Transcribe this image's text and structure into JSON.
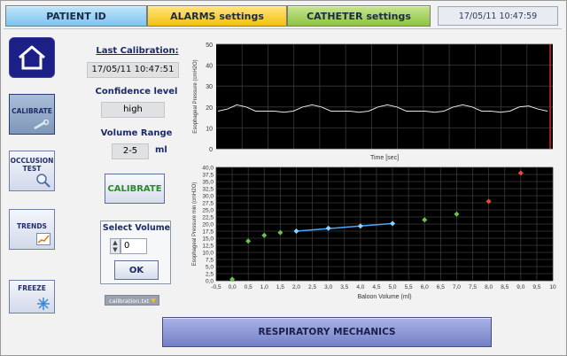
{
  "tabs": {
    "patient": "PATIENT ID",
    "alarms": "ALARMS settings",
    "catheter": "CATHETER settings"
  },
  "datetime": "17/05/11 10:47:59",
  "sidebar": {
    "home_icon": "home-icon",
    "calibrate": "CALIBRATE",
    "occlusion_1": "OCCLUSION",
    "occlusion_2": "TEST",
    "trends": "TRENDS",
    "freeze": "FREEZE"
  },
  "calibration": {
    "last_label": "Last Calibration:",
    "last_value": "17/05/11 10:47:51",
    "confidence_label": "Confidence level",
    "confidence_value": "high",
    "volume_label": "Volume Range",
    "volume_value": "2-5",
    "volume_unit": "ml",
    "calibrate_button": "CALIBRATE"
  },
  "select_volume": {
    "title": "Select Volume",
    "value": "0",
    "ok": "OK"
  },
  "file_dropdown": "calibration.txt",
  "bottom_button": "RESPIRATORY MECHANICS",
  "chart_data": [
    {
      "type": "line",
      "title": "",
      "xlabel": "Time [sec]",
      "ylabel": "Esophageal Pressure (cmH2O)",
      "ylim": [
        0,
        50
      ],
      "yticks": [
        0,
        10,
        20,
        30,
        40,
        50
      ],
      "grid": true,
      "background": "#000000",
      "series": [
        {
          "color": "#e8e8e8",
          "description": "esophageal pressure waveform oscillating around 18-20 cmH2O",
          "values": [
            18,
            19,
            21,
            20,
            18,
            18,
            18,
            17.5,
            18,
            20,
            21,
            20,
            18,
            18,
            18,
            17.5,
            18,
            20,
            21,
            20,
            18,
            18,
            18,
            17.5,
            18,
            20,
            21,
            20,
            18,
            18,
            17.5,
            18,
            20,
            20.5,
            19,
            18
          ]
        }
      ]
    },
    {
      "type": "scatter",
      "title": "",
      "xlabel": "Baloon Volume (ml)",
      "ylabel": "Esophageal Pressure min (cmH2O)",
      "xlim": [
        -0.5,
        10
      ],
      "ylim": [
        0,
        40
      ],
      "xticks": [
        "-0,5",
        "0,0",
        "0,5",
        "1,0",
        "1,5",
        "2,0",
        "2,5",
        "3,0",
        "3,5",
        "4,0",
        "4,5",
        "5,0",
        "5,5",
        "6,0",
        "6,5",
        "7,0",
        "7,5",
        "8,0",
        "8,5",
        "9,0",
        "9,5",
        "10"
      ],
      "yticks": [
        "0,0",
        "2,5",
        "5,0",
        "7,5",
        "10,0",
        "12,5",
        "15,0",
        "17,5",
        "20,0",
        "22,5",
        "25,0",
        "27,5",
        "30,0",
        "32,5",
        "35,0",
        "37,5",
        "40,0"
      ],
      "grid": true,
      "background": "#000000",
      "series": [
        {
          "name": "",
          "color": "#6cc24a",
          "points": [
            [
              0,
              0.5
            ],
            [
              0.5,
              14
            ],
            [
              1,
              16
            ],
            [
              1.5,
              17
            ],
            [
              6,
              21.5
            ],
            [
              7,
              23.5
            ]
          ]
        },
        {
          "name": "",
          "color": "#8fd3ff",
          "points": [
            [
              2,
              17.5
            ],
            [
              3,
              18.5
            ],
            [
              4,
              19.3
            ],
            [
              5,
              20.2
            ]
          ]
        },
        {
          "name": "",
          "color": "#e84a3a",
          "points": [
            [
              8,
              28
            ],
            [
              9,
              38
            ]
          ]
        }
      ],
      "fit_line": {
        "color": "#4aa8ff",
        "x": [
          2,
          5
        ],
        "y": [
          17.5,
          20.2
        ]
      }
    }
  ]
}
